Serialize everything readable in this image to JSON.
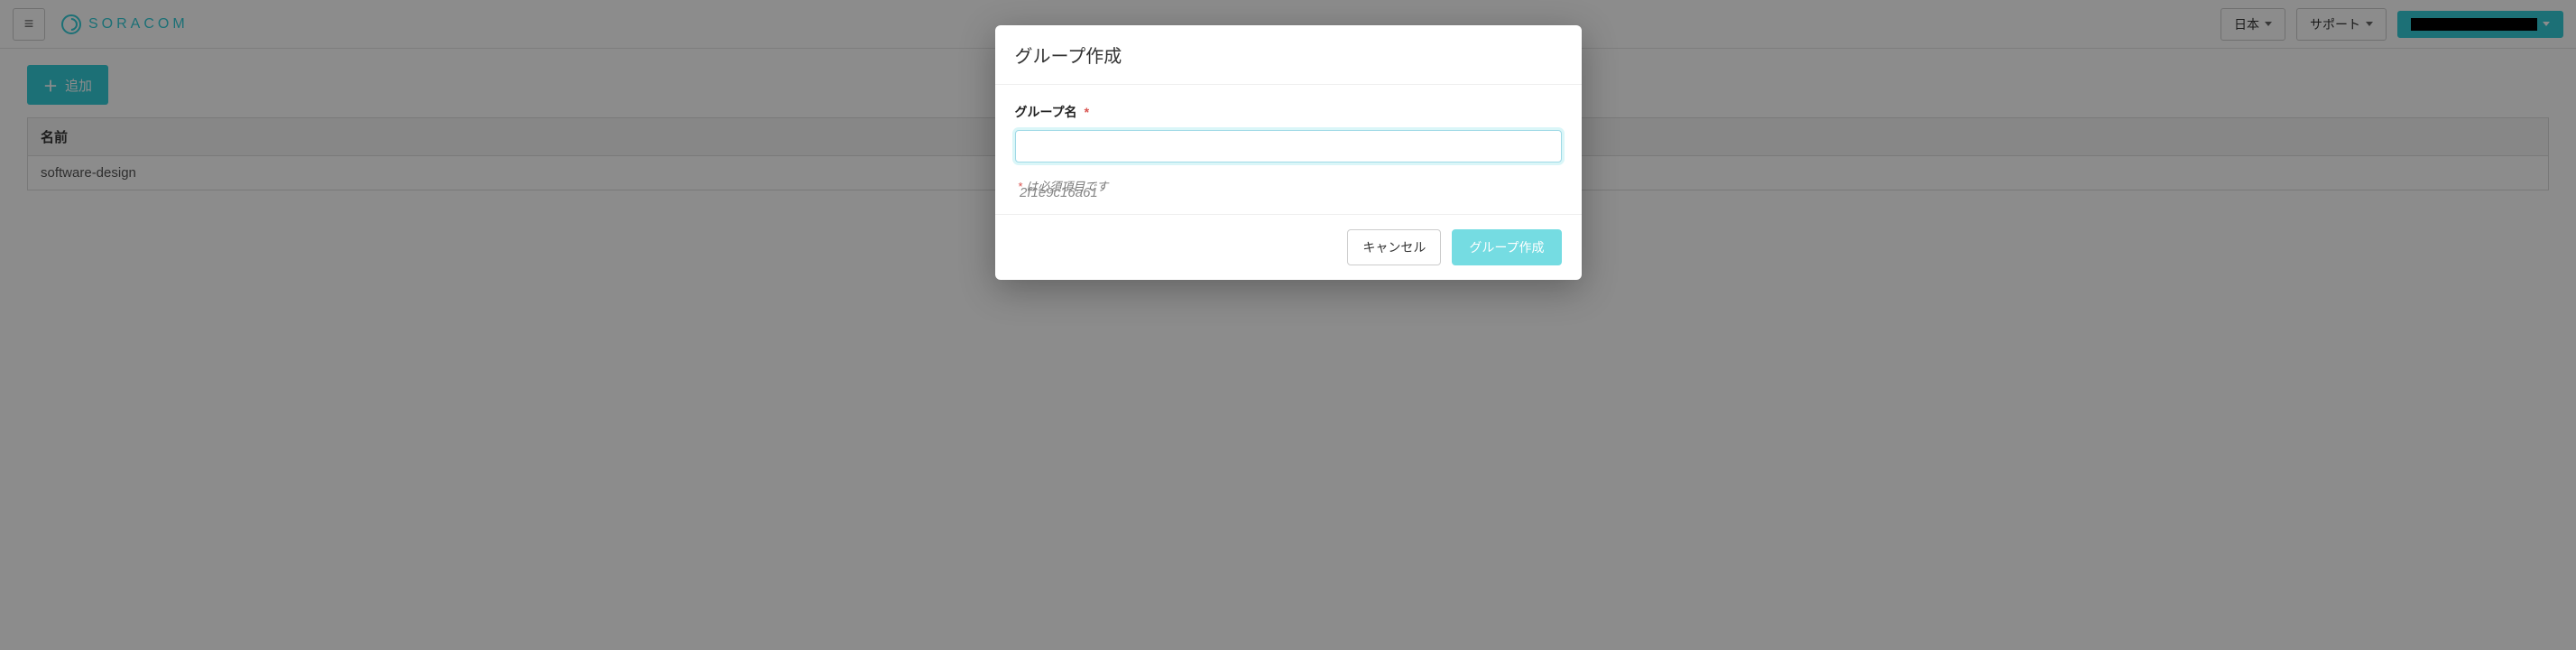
{
  "topbar": {
    "brand": "SORACOM",
    "lang_label": "日本",
    "support_label": "サポート"
  },
  "page": {
    "add_button": "追加",
    "columns": {
      "name": "名前"
    },
    "rows": [
      {
        "name": "software-design",
        "id_suffix": "2f1e9c16a61"
      }
    ]
  },
  "modal": {
    "title": "グループ作成",
    "field_label": "グループ名",
    "required_mark": "*",
    "input_value": "",
    "required_hint": "は必須項目です",
    "cancel": "キャンセル",
    "submit": "グループ作成"
  }
}
